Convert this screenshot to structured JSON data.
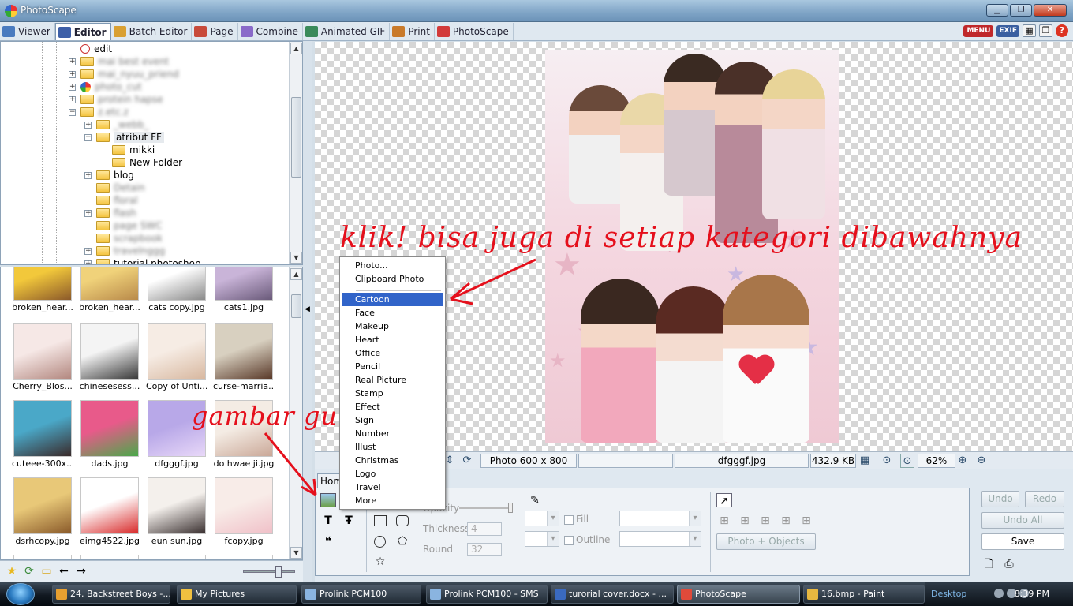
{
  "window": {
    "title": "PhotoScape",
    "controls": [
      "▁",
      "❐",
      "✕"
    ]
  },
  "tabs": [
    {
      "label": "Viewer",
      "color": "#4a7bbf"
    },
    {
      "label": "Editor",
      "color": "#3d5fa8"
    },
    {
      "label": "Batch Editor",
      "color": "#d9a032"
    },
    {
      "label": "Page",
      "color": "#c84a3a"
    },
    {
      "label": "Combine",
      "color": "#8a6ac9"
    },
    {
      "label": "Animated GIF",
      "color": "#3a8a5a"
    },
    {
      "label": "Print",
      "color": "#c97a2a"
    },
    {
      "label": "PhotoScape",
      "color": "#d23a3a"
    }
  ],
  "top_right": {
    "menu": "MENU",
    "exif": "EXIF"
  },
  "tree": [
    {
      "label": "edit",
      "blur": false
    },
    {
      "label": "mai best event",
      "blur": true
    },
    {
      "label": "mai_nyuu_priend",
      "blur": true
    },
    {
      "label": "photo_cut",
      "blur": true
    },
    {
      "label": "protein hapse",
      "blur": true
    },
    {
      "label": "z.etc.z",
      "blur": true
    },
    {
      "label": "_webb_",
      "blur": true
    },
    {
      "label": "atribut FF",
      "blur": false
    },
    {
      "label": "mikki",
      "blur": false
    },
    {
      "label": "New Folder",
      "blur": false
    },
    {
      "label": "blog",
      "blur": false
    },
    {
      "label": "Detain",
      "blur": true
    },
    {
      "label": "floral",
      "blur": true
    },
    {
      "label": "flash",
      "blur": true
    },
    {
      "label": "page SWC",
      "blur": true
    },
    {
      "label": "scrapbook",
      "blur": true
    },
    {
      "label": "travelnggg",
      "blur": true
    },
    {
      "label": "tutorial photoshop",
      "blur": false
    }
  ],
  "thumbnails": [
    {
      "label": "broken_hear...",
      "c1": "#f2c83b",
      "c2": "#8c5a2a"
    },
    {
      "label": "broken_hear...",
      "c1": "#f0d27a",
      "c2": "#b98a4a"
    },
    {
      "label": "cats copy.jpg",
      "c1": "#ffffff",
      "c2": "#8a8a8a"
    },
    {
      "label": "cats1.jpg",
      "c1": "#c9b4d8",
      "c2": "#6a5a7a"
    },
    {
      "label": "Cherry_Blos...",
      "c1": "#f6e8e6",
      "c2": "#b38880"
    },
    {
      "label": "chinesesess...",
      "c1": "#f4f4f4",
      "c2": "#3a3a3a"
    },
    {
      "label": "Copy of Unti...",
      "c1": "#f6ece4",
      "c2": "#d8b8a0"
    },
    {
      "label": "curse-marria...",
      "c1": "#d8d0c0",
      "c2": "#5a3a2a"
    },
    {
      "label": "cuteee-300x...",
      "c1": "#4aa8c8",
      "c2": "#3a2a2a"
    },
    {
      "label": "dads.jpg",
      "c1": "#e85a8a",
      "c2": "#4aa84a"
    },
    {
      "label": "dfgggf.jpg",
      "c1": "#b8a8e8",
      "c2": "#e8d8f8"
    },
    {
      "label": "do hwae ji.jpg",
      "c1": "#f4ece4",
      "c2": "#caa898"
    },
    {
      "label": "dsrhcopy.jpg",
      "c1": "#e8c878",
      "c2": "#8a5a2a"
    },
    {
      "label": "eimg4522.jpg",
      "c1": "#ffffff",
      "c2": "#d82a2a"
    },
    {
      "label": "eun sun.jpg",
      "c1": "#f4f0ec",
      "c2": "#3a3030"
    },
    {
      "label": "fcopy.jpg",
      "c1": "#f8ece8",
      "c2": "#f0c0c8"
    }
  ],
  "status": {
    "photo_size": "Photo 600 x 800",
    "file_name": "dfgggf.jpg",
    "file_size": "432.9 KB",
    "zoom": "62%"
  },
  "editor": {
    "home_tab": "Hom",
    "tab_partial": "s",
    "opacity_label": "Opacity",
    "thickness_label": "Thickness",
    "thickness_value": "4",
    "round_label": "Round",
    "round_value": "32",
    "fill_label": "Fill",
    "outline_label": "Outline",
    "photo_objects": "Photo + Objects",
    "undo": "Undo",
    "redo": "Redo",
    "undo_all": "Undo All",
    "save": "Save"
  },
  "context_menu": {
    "top": [
      "Photo...",
      "Clipboard Photo"
    ],
    "items": [
      "Cartoon",
      "Face",
      "Makeup",
      "Heart",
      "Office",
      "Pencil",
      "Real Picture",
      "Stamp",
      "Effect",
      "Sign",
      "Number",
      "Illust",
      "Christmas",
      "Logo",
      "Travel",
      "More"
    ],
    "selected": "Cartoon"
  },
  "annotations": {
    "top": "klik! bisa juga di setiap kategori dibawahnya",
    "bottom": "gambar gunung"
  },
  "taskbar": {
    "items": [
      {
        "label": "24. Backstreet Boys -...",
        "color": "#e8a030"
      },
      {
        "label": "My Pictures",
        "color": "#f0c040"
      },
      {
        "label": "Prolink PCM100",
        "color": "#8ab4e0"
      },
      {
        "label": "Prolink PCM100 - SMS",
        "color": "#8ab4e0"
      },
      {
        "label": "turorial cover.docx - ...",
        "color": "#3a6ac0"
      },
      {
        "label": "PhotoScape",
        "color": "#e04a3a"
      },
      {
        "label": "16.bmp - Paint",
        "color": "#e8b840"
      }
    ],
    "desktop": "Desktop",
    "clock": "8:39 PM"
  }
}
